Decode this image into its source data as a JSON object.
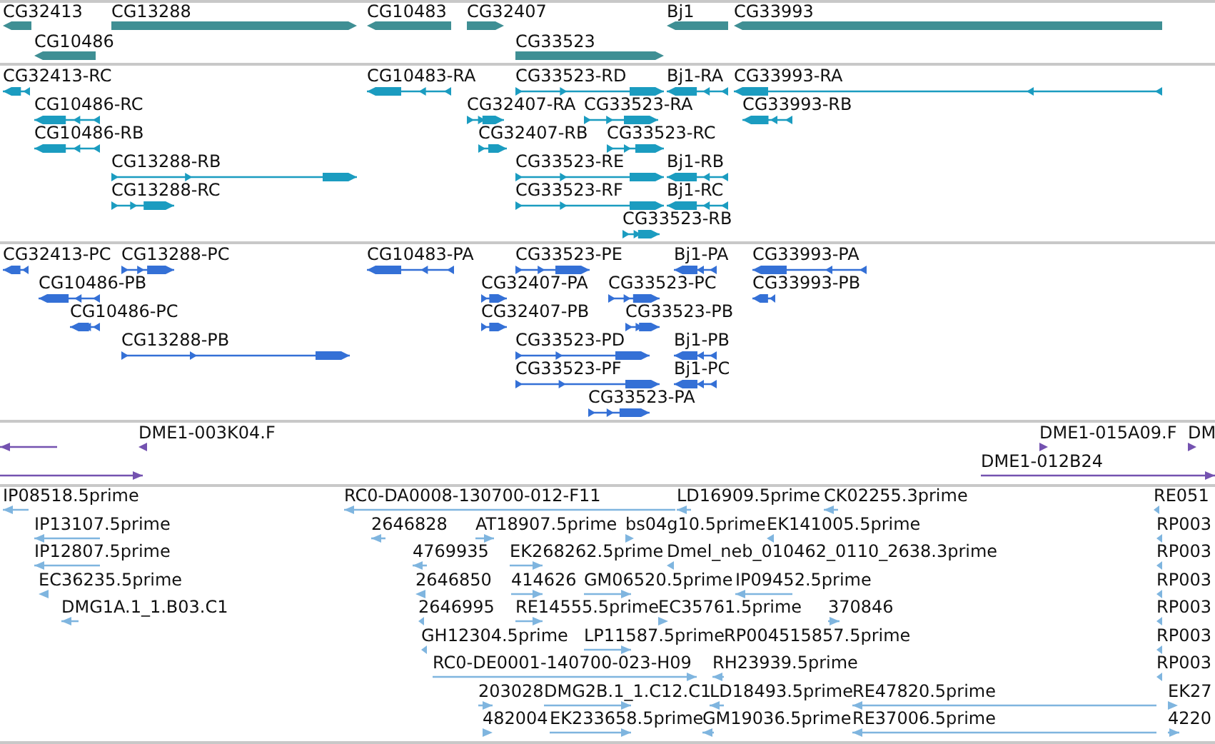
{
  "tracks": [
    {
      "kind": "gene",
      "color": "#3f8f94",
      "features": [
        {
          "label": "CG32413",
          "reverse": true
        },
        {
          "label": "CG13288",
          "reverse": false
        },
        {
          "label": "CG10483",
          "reverse": true
        },
        {
          "label": "CG32407",
          "reverse": false
        },
        {
          "label": "Bj1",
          "reverse": true
        },
        {
          "label": "CG33993",
          "reverse": true
        },
        {
          "label": "CG10486",
          "reverse": true
        },
        {
          "label": "CG33523",
          "reverse": false
        }
      ]
    },
    {
      "kind": "transcript",
      "color": "#1b9cc0",
      "features": [
        {
          "label": "CG32413-RC",
          "reverse": true
        },
        {
          "label": "CG10483-RA",
          "reverse": true
        },
        {
          "label": "CG33523-RD",
          "reverse": false
        },
        {
          "label": "Bj1-RA",
          "reverse": true
        },
        {
          "label": "CG33993-RA",
          "reverse": true
        },
        {
          "label": "CG10486-RC",
          "reverse": true
        },
        {
          "label": "CG32407-RA",
          "reverse": false
        },
        {
          "label": "CG33523-RA",
          "reverse": false
        },
        {
          "label": "CG33993-RB",
          "reverse": true
        },
        {
          "label": "CG10486-RB",
          "reverse": true
        },
        {
          "label": "CG32407-RB",
          "reverse": false
        },
        {
          "label": "CG33523-RC",
          "reverse": false
        },
        {
          "label": "CG13288-RB",
          "reverse": false
        },
        {
          "label": "CG33523-RE",
          "reverse": false
        },
        {
          "label": "Bj1-RB",
          "reverse": true
        },
        {
          "label": "CG13288-RC",
          "reverse": false
        },
        {
          "label": "CG33523-RF",
          "reverse": false
        },
        {
          "label": "Bj1-RC",
          "reverse": true
        },
        {
          "label": "CG33523-RB",
          "reverse": false
        }
      ]
    },
    {
      "kind": "transcript",
      "color": "#3470d6",
      "features": [
        {
          "label": "CG32413-PC",
          "reverse": true
        },
        {
          "label": "CG13288-PC",
          "reverse": false
        },
        {
          "label": "CG10483-PA",
          "reverse": true
        },
        {
          "label": "CG33523-PE",
          "reverse": false
        },
        {
          "label": "Bj1-PA",
          "reverse": true
        },
        {
          "label": "CG33993-PA",
          "reverse": true
        },
        {
          "label": "CG10486-PB",
          "reverse": true
        },
        {
          "label": "CG32407-PA",
          "reverse": false
        },
        {
          "label": "CG33523-PC",
          "reverse": false
        },
        {
          "label": "CG33993-PB",
          "reverse": true
        },
        {
          "label": "CG10486-PC",
          "reverse": true
        },
        {
          "label": "CG32407-PB",
          "reverse": false
        },
        {
          "label": "CG33523-PB",
          "reverse": false
        },
        {
          "label": "CG13288-PB",
          "reverse": false
        },
        {
          "label": "CG33523-PD",
          "reverse": false
        },
        {
          "label": "Bj1-PB",
          "reverse": true
        },
        {
          "label": "CG33523-PF",
          "reverse": false
        },
        {
          "label": "Bj1-PC",
          "reverse": true
        },
        {
          "label": "CG33523-PA",
          "reverse": false
        }
      ]
    },
    {
      "kind": "read",
      "color": "#7452b0",
      "features": [
        {
          "reverse": true
        },
        {
          "label": "DME1-003K04.F",
          "reverse": true
        },
        {
          "label": "DME1-015A09.F",
          "reverse": false
        },
        {
          "label": "DM",
          "reverse": false
        },
        {
          "reverse": false
        },
        {
          "label": "DME1-012B24",
          "reverse": false
        }
      ]
    },
    {
      "kind": "read",
      "color": "#7fb5df",
      "features": [
        {
          "label": "IP08518.5prime",
          "reverse": true
        },
        {
          "label": "RC0-DA0008-130700-012-F11",
          "reverse": true
        },
        {
          "label": "LD16909.5prime",
          "reverse": true
        },
        {
          "label": "CK02255.3prime",
          "reverse": true
        },
        {
          "label": "RE051",
          "reverse": true
        },
        {
          "label": "IP13107.5prime",
          "reverse": true
        },
        {
          "label": "2646828",
          "reverse": true
        },
        {
          "label": "AT18907.5prime",
          "reverse": false
        },
        {
          "label": "bs04g10.5prime",
          "reverse": false
        },
        {
          "label": "EK141005.5prime",
          "reverse": true
        },
        {
          "label": "RP003",
          "reverse": true
        },
        {
          "label": "IP12807.5prime",
          "reverse": true
        },
        {
          "label": "4769935",
          "reverse": true
        },
        {
          "label": "EK268262.5prime",
          "reverse": false
        },
        {
          "label": "Dmel_neb_010462_0110_2638.3prime",
          "reverse": true
        },
        {
          "label": "RP003",
          "reverse": true
        },
        {
          "label": "EC36235.5prime",
          "reverse": true
        },
        {
          "label": "2646850",
          "reverse": true
        },
        {
          "label": "414626",
          "reverse": false
        },
        {
          "label": "GM06520.5prime",
          "reverse": false
        },
        {
          "label": "IP09452.5prime",
          "reverse": true
        },
        {
          "label": "RP003",
          "reverse": true
        },
        {
          "label": "DMG1A.1_1.B03.C1",
          "reverse": true
        },
        {
          "label": "2646995",
          "reverse": true
        },
        {
          "label": "RE14555.5prime",
          "reverse": false
        },
        {
          "label": "EC35761.5prime",
          "reverse": false
        },
        {
          "label": "370846",
          "reverse": false
        },
        {
          "label": "RP003",
          "reverse": true
        },
        {
          "label": "GH12304.5prime",
          "reverse": true
        },
        {
          "label": "LP11587.5prime",
          "reverse": false
        },
        {
          "label": "RP004515857.5prime"
        },
        {
          "label": "RP003",
          "reverse": true
        },
        {
          "label": "RC0-DE0001-140700-023-H09",
          "reverse": false
        },
        {
          "label": "RH23939.5prime",
          "reverse": true
        },
        {
          "label": "RP003",
          "reverse": true
        },
        {
          "label": "203028",
          "reverse": false
        },
        {
          "label": "DMG2B.1_1.C12.C1",
          "reverse": false
        },
        {
          "label": "LD18493.5prime",
          "reverse": true
        },
        {
          "label": "RE47820.5prime",
          "reverse": true
        },
        {
          "label": "EK27",
          "reverse": false
        },
        {
          "label": "482004",
          "reverse": false
        },
        {
          "label": "EK233658.5prime",
          "reverse": false
        },
        {
          "label": "GM19036.5prime",
          "reverse": true
        },
        {
          "label": "RE37006.5prime",
          "reverse": true
        },
        {
          "label": "4220",
          "reverse": false
        }
      ]
    }
  ]
}
